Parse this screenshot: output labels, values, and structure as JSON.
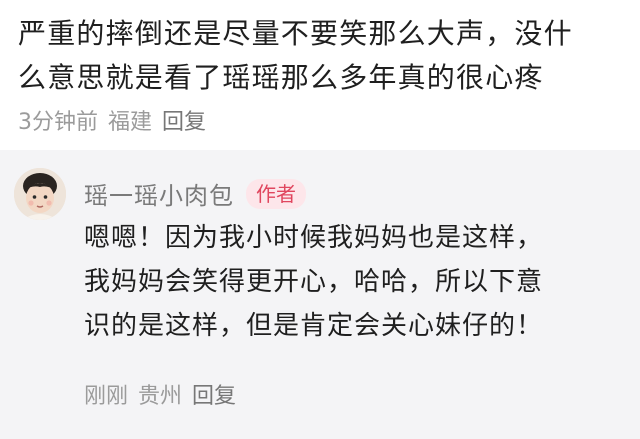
{
  "comment": {
    "line1": "严重的摔倒还是尽量不要笑那么大声，没什",
    "line2": "么意思就是看了瑶瑶那么多年真的很心疼",
    "time": "3分钟前",
    "location": "福建",
    "reply_label": "回复"
  },
  "reply": {
    "author": "瑶一瑶小肉包",
    "badge": "作者",
    "line1": "嗯嗯！因为我小时候我妈妈也是这样，",
    "line2": "我妈妈会笑得更开心，哈哈，所以下意",
    "line3": "识的是这样，但是肯定会关心妹仔的！",
    "time": "刚刚",
    "location": "贵州",
    "reply_label": "回复"
  },
  "colors": {
    "badge_text": "#e0465e",
    "badge_bg": "#fde6ea",
    "reply_bg": "#f4f4f6"
  },
  "icons": {
    "avatar": "child-avatar-icon"
  }
}
